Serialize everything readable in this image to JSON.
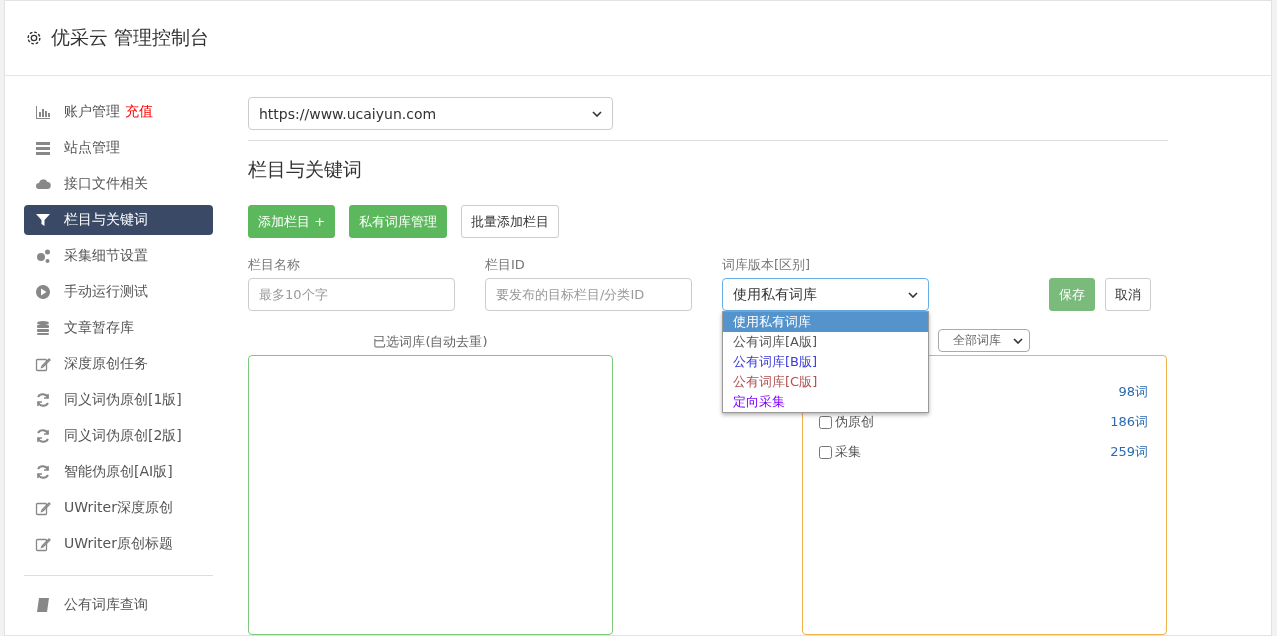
{
  "header": {
    "title": "优采云 管理控制台"
  },
  "sidebar": {
    "items": [
      {
        "label": "账户管理",
        "badge": "充值",
        "kind": "chart",
        "selected": false
      },
      {
        "label": "站点管理",
        "kind": "server",
        "selected": false
      },
      {
        "label": "接口文件相关",
        "kind": "cloud",
        "selected": false
      },
      {
        "label": "栏目与关键词",
        "kind": "filter",
        "selected": true
      },
      {
        "label": "采集细节设置",
        "kind": "gears",
        "selected": false
      },
      {
        "label": "手动运行测试",
        "kind": "play",
        "selected": false
      },
      {
        "label": "文章暂存库",
        "kind": "database",
        "selected": false
      },
      {
        "label": "深度原创任务",
        "kind": "edit",
        "selected": false
      },
      {
        "label": "同义词伪原创[1版]",
        "kind": "refresh",
        "selected": false
      },
      {
        "label": "同义词伪原创[2版]",
        "kind": "refresh",
        "selected": false
      },
      {
        "label": "智能伪原创[AI版]",
        "kind": "refresh",
        "selected": false
      },
      {
        "label": "UWriter深度原创",
        "kind": "edit",
        "selected": false
      },
      {
        "label": "UWriter原创标题",
        "kind": "edit",
        "selected": false
      }
    ],
    "bottom_items": [
      {
        "label": "公有词库查询",
        "kind": "book",
        "selected": false
      }
    ]
  },
  "site_select": {
    "value": "https://www.ucaiyun.com"
  },
  "section_title": "栏目与关键词",
  "actions": [
    {
      "label": "添加栏目 +",
      "kind": "primary"
    },
    {
      "label": "私有词库管理",
      "kind": "primary"
    },
    {
      "label": "批量添加栏目",
      "kind": "default"
    }
  ],
  "form": {
    "fields": [
      {
        "label": "栏目名称",
        "placeholder": "最多10个字",
        "kind": "input"
      },
      {
        "label": "栏目ID",
        "placeholder": "要发布的目标栏目/分类ID",
        "kind": "input"
      },
      {
        "label": "词库版本[区别]",
        "value": "使用私有词库",
        "kind": "select",
        "expanded": true,
        "options": [
          {
            "label": "使用私有词库",
            "selected": true
          },
          {
            "label": "公有词库[A版]",
            "selected": false,
            "color": "#555555"
          },
          {
            "label": "公有词库[B版]",
            "selected": false,
            "color": "#3b3bd9"
          },
          {
            "label": "公有词库[C版]",
            "selected": false,
            "color": "#b05050"
          },
          {
            "label": "定向采集",
            "selected": false,
            "color": "#8000ff"
          }
        ]
      }
    ],
    "buttons": [
      {
        "label": "保存",
        "kind": "primary"
      },
      {
        "label": "取消",
        "kind": "default"
      }
    ]
  },
  "selected_panel": {
    "title": "已选词库(自动去重)"
  },
  "library_panel": {
    "filter": "全部词库",
    "rows": [
      {
        "count": "98词"
      },
      {
        "label": "伪原创",
        "count": "186词",
        "checked": false
      },
      {
        "label": "采集",
        "count": "259词",
        "checked": false
      }
    ]
  }
}
